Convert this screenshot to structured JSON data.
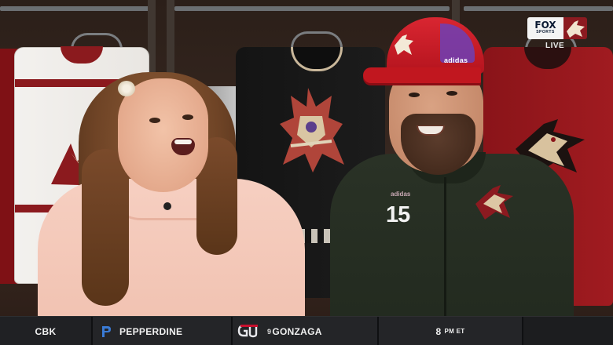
{
  "broadcast": {
    "network": "FOX SPORTS",
    "network_short": "FOX",
    "network_sub": "SPORTS",
    "status": "LIVE",
    "team_bug_icon": "coyote-head-icon"
  },
  "scene": {
    "player_number": "15",
    "hoodie_brand": "adidas",
    "cap_brand": "adidas"
  },
  "ticker": {
    "network": "CBK",
    "team1": {
      "name": "PEPPERDINE",
      "icon": "pepperdine-logo-icon"
    },
    "team2": {
      "rank": "9",
      "name": "GONZAGA",
      "icon": "gonzaga-logo-icon"
    },
    "time": {
      "hour": "8",
      "suffix": "PM ET"
    }
  },
  "colors": {
    "coyotes_red": "#8c1a20",
    "ticker_bg": "#1f2022",
    "cap_red": "#d92631"
  }
}
